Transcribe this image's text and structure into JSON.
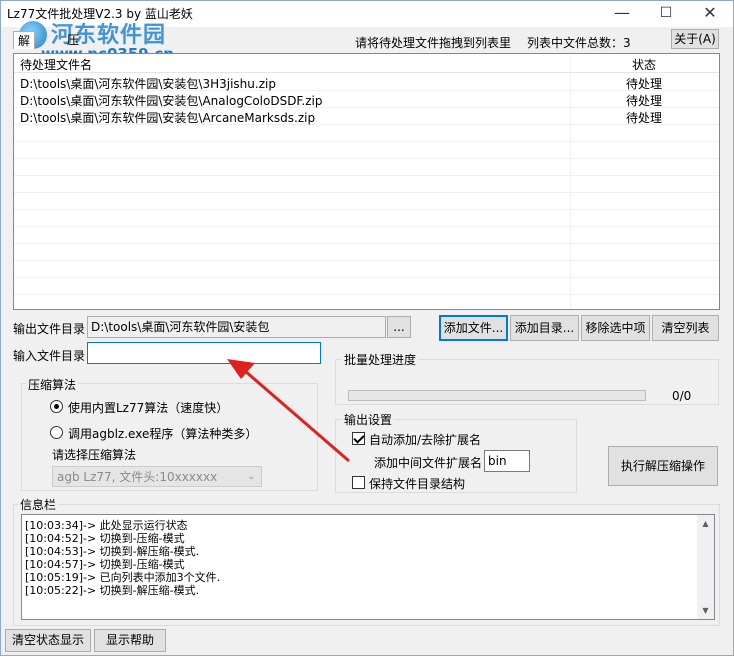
{
  "window": {
    "title": "Lz77文件批处理V2.3 by 蓝山老妖"
  },
  "watermark": {
    "brand": "河东软件园",
    "url": "www.pc0359.cn"
  },
  "controls": {
    "minimize": "—",
    "maximize": "☐",
    "close": "✕"
  },
  "tabs": [
    "解压缩",
    "压缩"
  ],
  "header": {
    "hint": "请将待处理文件拖拽到列表里",
    "count_label": "列表中文件总数：",
    "count": "3",
    "about": "关于(A)"
  },
  "list": {
    "columns": [
      "待处理文件名",
      "状态"
    ],
    "rows": [
      {
        "file": "D:\\tools\\桌面\\河东软件园\\安装包\\3H3jishu.zip",
        "status": "待处理"
      },
      {
        "file": "D:\\tools\\桌面\\河东软件园\\安装包\\AnalogColoDSDF.zip",
        "status": "待处理"
      },
      {
        "file": "D:\\tools\\桌面\\河东软件园\\安装包\\ArcaneMarksds.zip",
        "status": "待处理"
      }
    ]
  },
  "output_dir": {
    "label": "输出文件目录",
    "value": "D:\\tools\\桌面\\河东软件园\\安装包",
    "browse": "..."
  },
  "input_dir": {
    "label": "输入文件目录",
    "value": ""
  },
  "buttons": {
    "add_file": "添加文件...",
    "add_dir": "添加目录...",
    "remove_sel": "移除选中项",
    "clear_list": "清空列表",
    "execute": "执行解压缩操作",
    "clear_status": "清空状态显示",
    "help": "显示帮助"
  },
  "progress": {
    "label": "批量处理进度",
    "value": "0/0",
    "fraction": 0
  },
  "algo": {
    "title": "压缩算法",
    "opt1": "使用内置Lz77算法（速度快）",
    "opt2": "调用agblz.exe程序（算法种类多）",
    "select_label": "请选择压缩算法",
    "select_value": "agb Lz77, 文件头:10xxxxxx"
  },
  "output_settings": {
    "title": "输出设置",
    "auto_ext": "自动添加/去除扩展名",
    "mid_ext_label": "添加中间文件扩展名",
    "mid_ext_value": "bin",
    "keep_struct": "保持文件目录结构"
  },
  "info": {
    "title": "信息栏",
    "lines": [
      "[10:03:34]-> 此处显示运行状态",
      "[10:04:52]-> 切换到-压缩-模式",
      "[10:04:53]-> 切换到-解压缩-模式.",
      "[10:04:57]-> 切换到-压缩-模式",
      "[10:05:19]-> 已向列表中添加3个文件.",
      "[10:05:22]-> 切换到-解压缩-模式."
    ]
  },
  "colors": {
    "arrow": "#e02020",
    "accent": "#0078d7"
  }
}
